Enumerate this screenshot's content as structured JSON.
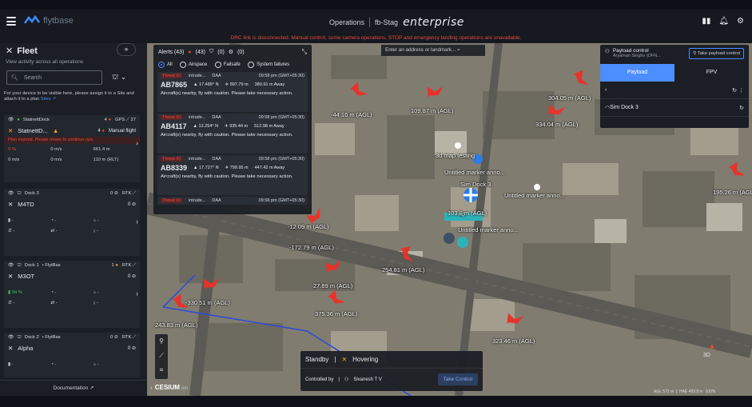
{
  "topbar": {
    "logo": "flytbase",
    "section": "Operations",
    "org": "fb-Stag",
    "tier": "enterprise"
  },
  "banner": "DRC link is disconnected. Manual control, some camera operations, STOP and emergency landing operations are unavailable.",
  "sidebar": {
    "title": "Fleet",
    "subtitle": "View activity across all operations",
    "search_placeholder": "Search",
    "hint": "For your device to be visible here, please assign it to a Site and attach it to a plan",
    "hint_link": "Sites",
    "footer": "Documentation",
    "cards": [
      {
        "dock": "StatnettDock",
        "count": "4",
        "signal": "GPS",
        "signal_val": "27",
        "drone": "StatnettD...",
        "drone_count": "4",
        "mode": "Manual flight",
        "alert": "Plan expired. Please renew to continue ops.",
        "stats1": [
          "0 %",
          "0 m/s",
          "661.4 m"
        ],
        "stats2": [
          "0 m/s",
          "0 m/s",
          "110 m (RLT)"
        ]
      },
      {
        "dock": "Dock 3",
        "count": "0",
        "signal": "RTK",
        "drone": "M4TD",
        "drone_count": "0",
        "stats1": [
          "-",
          "-",
          "-"
        ],
        "stats2": [
          "-",
          "-",
          "-"
        ]
      },
      {
        "dock": "Dock 1",
        "site": "FlytBas",
        "count": "1",
        "signal": "RTK",
        "drone": "M3OT",
        "drone_count": "0",
        "stats1": [
          "94 %",
          "-",
          "-"
        ],
        "stats2": [
          "-",
          "-",
          "-"
        ]
      },
      {
        "dock": "Dock 2",
        "site": "FlytBas",
        "count": "0",
        "signal": "RTK",
        "drone": "Alpha",
        "drone_count": "0",
        "stats1": [
          "-",
          "-",
          "-"
        ]
      }
    ]
  },
  "alerts": {
    "title": "Alerts (43)",
    "red_count": "(43)",
    "shield_count": "(0)",
    "gear_count": "(0)",
    "filters": [
      "All",
      "Airspace",
      "Failsafe",
      "System failures"
    ],
    "items": [
      {
        "tag": "Threat ID",
        "type": "intrude...",
        "src": "DAA",
        "time": "09:58 pm (GMT+05:30)",
        "id": "AB7865",
        "lat": "17.489° N",
        "alt": "897.79 m",
        "dist": "380.91 m Away",
        "msg": "Aircraft(s) nearby, fly with caution. Please take necessary action."
      },
      {
        "tag": "Threat ID",
        "type": "intrude...",
        "src": "DAA",
        "time": "09:58 pm (GMT+05:30)",
        "id": "AB4117",
        "lat": "12.254° N",
        "alt": "935.44 m",
        "dist": "512.98 m Away",
        "msg": "Aircraft(s) nearby, fly with caution. Please take necessary action."
      },
      {
        "tag": "Threat ID",
        "type": "intrude...",
        "src": "DAA",
        "time": "09:58 pm (GMT+05:30)",
        "id": "AB8339",
        "lat": "17.727° N",
        "alt": "799.95 m",
        "dist": "447.42 m Away",
        "msg": "Aircraft(s) nearby, fly with caution. Please take necessary action."
      },
      {
        "tag": "Threat ID",
        "type": "intrude...",
        "src": "DAA",
        "time": "09:58 pm (GMT+05:30)"
      }
    ]
  },
  "map": {
    "address_placeholder": "Enter an address or landmark...",
    "labels": [
      "-44.16 m (AGL)",
      "109.87 m (AGL)",
      "304.05 m (AGL)",
      "334.04 m (AGL)",
      "195.26 m (AGL)",
      "-12.09 m (AGL)",
      "-172.79 m (AGL)",
      "254.81 m (AGL)",
      "27.89 m (AGL)",
      "-330.51 m (AGL)",
      "243.83 m (AGL)",
      "375.36 m (AGL)",
      "323.46 m (AGL)",
      "103.8 m (AGL)"
    ],
    "markers": [
      "3d map testing",
      "Untitled marker anno...",
      "Sim Dock 3",
      "Untitled marker anno...",
      "Untitled marker anno...",
      "HQ"
    ],
    "cesium": "CESIUM",
    "cesium_suffix": "ion",
    "scale": "AGL 572 m",
    "hae": "HAE 499.8 m",
    "zoom": "100%",
    "view3d": "3D"
  },
  "payload": {
    "title": "Payload control",
    "user": "Aryaman Singhs (OFN...",
    "button": "Take payload control",
    "tabs": [
      "Payload",
      "FPV"
    ],
    "dock": "Sim Dock 3"
  },
  "modebar": {
    "state": "Standby",
    "mode": "Hovering",
    "controlled_by_label": "Controlled by",
    "controller": "Sivanesh T V",
    "take_control": "Take Control"
  },
  "colors": {
    "accent": "#4c8dff",
    "alert": "#e5483e",
    "ok": "#3cc16b",
    "warn": "#f5a623",
    "plane": "#e8322a"
  }
}
